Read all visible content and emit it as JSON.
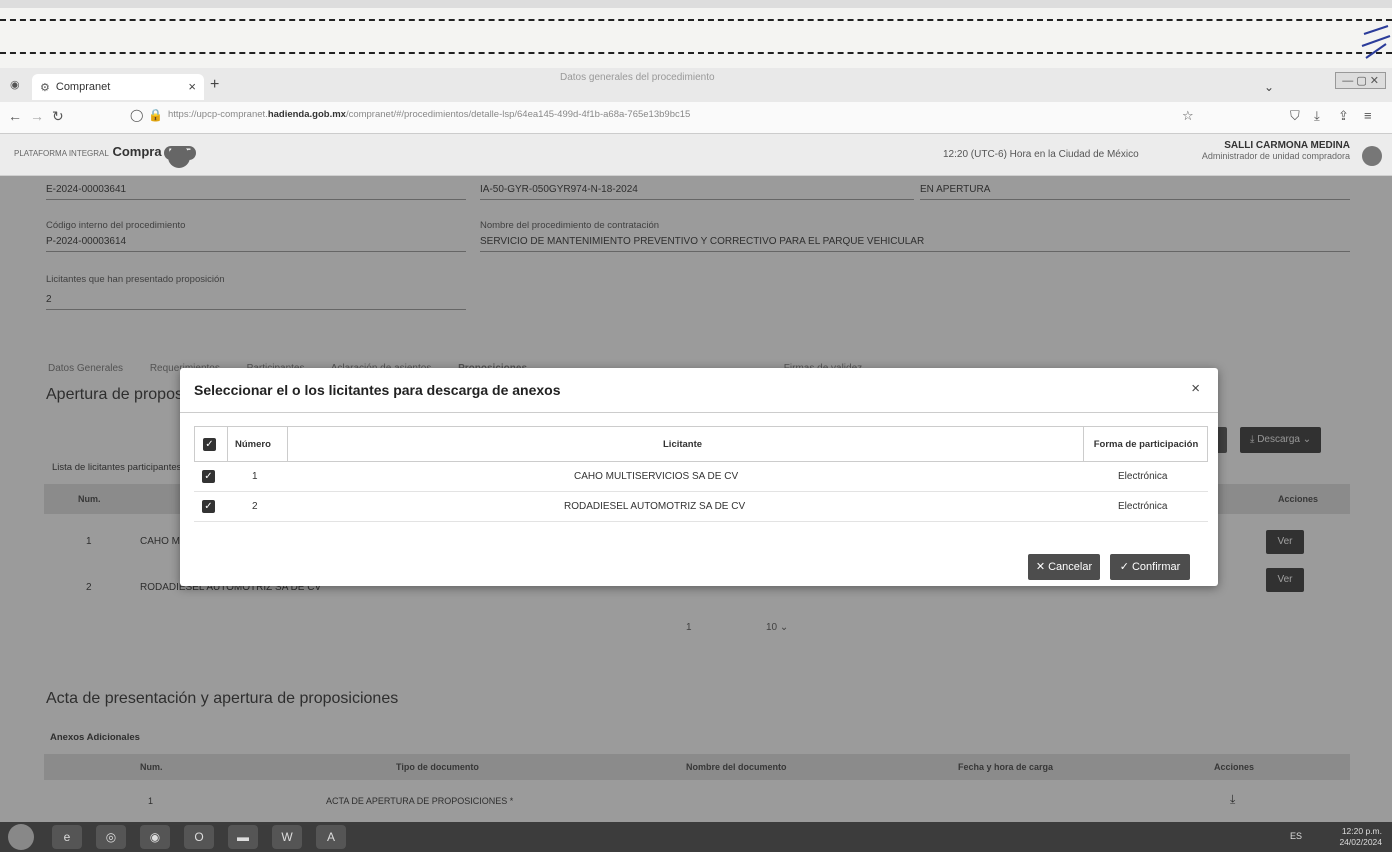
{
  "browser": {
    "tab_title": "Compranet",
    "tab_close": "×",
    "new_tab": "+",
    "ghost_tab": "Datos generales del procedimiento",
    "url_prefix": "https://upcp-compranet.",
    "url_domain": "hadienda.gob.mx",
    "url_rest": "/compranet/#/procedimientos/detalle-lsp/64ea145-499d-4f1b-a68a-765e13b9bc15",
    "window_controls": "— ▢ ✕",
    "tabs_dropdown": "⌄"
  },
  "header": {
    "logo_small": "PLATAFORMA INTEGRAL",
    "logo_text": "Compra",
    "logo_net": "NET",
    "time": "12:20 (UTC-6) Hora en la Ciudad de México",
    "user_name": "SALLI CARMONA MEDINA",
    "user_role": "Administrador de unidad compradora"
  },
  "procedure": {
    "number": "E-2024-00003641",
    "code": "IA-50-GYR-050GYR974-N-18-2024",
    "status": "EN APERTURA",
    "internal_code_label": "Código interno del procedimiento",
    "internal_code": "P-2024-00003614",
    "name_label": "Nombre del procedimiento de contratación",
    "name": "SERVICIO DE MANTENIMIENTO PREVENTIVO Y CORRECTIVO PARA EL PARQUE VEHICULAR",
    "bidders_label": "Licitantes que han presentado proposición",
    "bidders_count": "2"
  },
  "page_tabs": [
    "Datos Generales",
    "Requerimientos",
    "Participantes",
    "Aclaración de asientos",
    "Proposiciones",
    "",
    "",
    "Firmas de validez"
  ],
  "apertura": {
    "title": "Apertura de proposiciones",
    "list_label": "Lista de licitantes participantes",
    "col_num": "Num.",
    "col_actions": "Acciones",
    "rows": [
      {
        "num": "1",
        "name": "CAHO MULTISERVICIOS SA DE CV",
        "action": "Ver"
      },
      {
        "num": "2",
        "name": "RODADIESEL AUTOMOTRIZ SA DE CV",
        "action": "Ver"
      }
    ],
    "download_left": "do",
    "download_btn": "⤓ Descarga  ⌄",
    "pager_page": "1",
    "pager_size": "10 ⌄"
  },
  "acta": {
    "title": "Acta de presentación y apertura de proposiciones",
    "annex_label": "Anexos Adicionales",
    "cols": [
      "Num.",
      "Tipo de documento",
      "Nombre del documento",
      "Fecha y hora de carga",
      "Acciones"
    ],
    "rows": [
      {
        "num": "1",
        "type": "ACTA DE APERTURA DE PROPOSICIONES *",
        "action": "⤓"
      }
    ]
  },
  "modal": {
    "title": "Seleccionar el o los licitantes para descarga de anexos",
    "close": "×",
    "col_num": "Número",
    "col_bidder": "Licitante",
    "col_form": "Forma de participación",
    "rows": [
      {
        "num": "1",
        "bidder": "CAHO MULTISERVICIOS SA DE CV",
        "form": "Electrónica"
      },
      {
        "num": "2",
        "bidder": "RODADIESEL AUTOMOTRIZ SA DE CV",
        "form": "Electrónica"
      }
    ],
    "cancel": "✕ Cancelar",
    "confirm": "✓ Confirmar"
  },
  "taskbar": {
    "lang": "ES",
    "time": "12:20 p.m.",
    "date": "24/02/2024"
  }
}
